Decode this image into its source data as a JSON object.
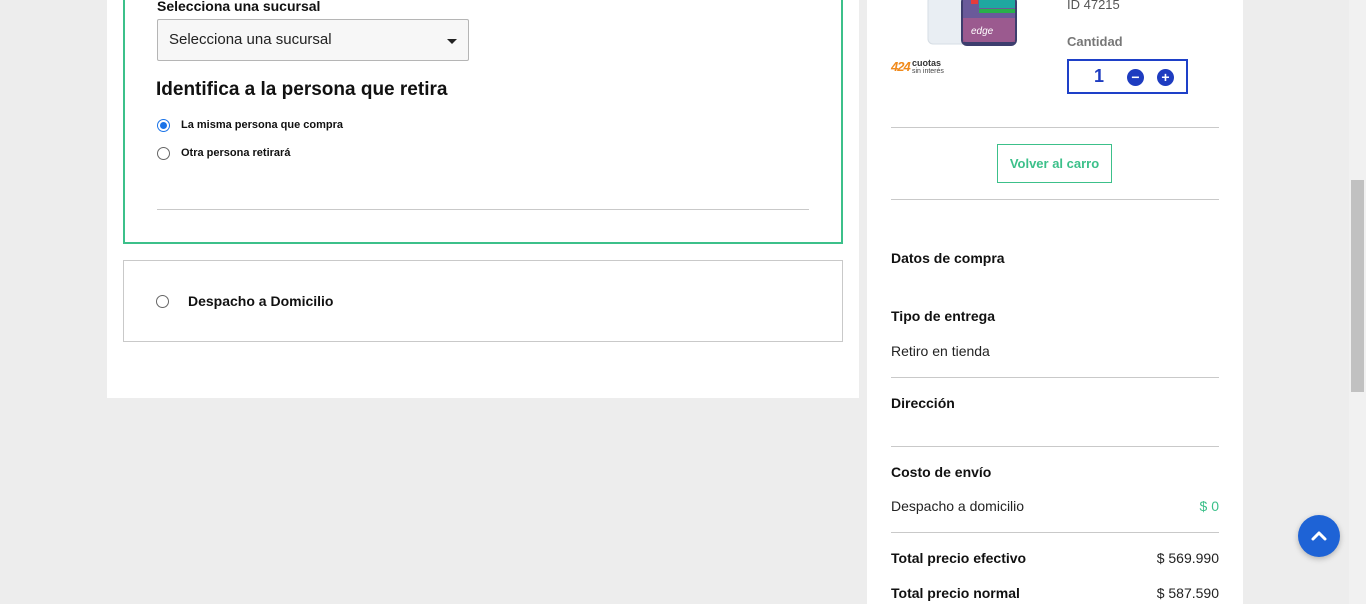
{
  "store_pickup": {
    "branch_label": "Selecciona una sucursal",
    "branch_select_value": "Selecciona una sucursal",
    "identify_title": "Identifica a la persona que retira",
    "options": [
      {
        "label": "La misma persona que compra",
        "checked": true
      },
      {
        "label": "Otra persona retirará",
        "checked": false
      }
    ]
  },
  "home_delivery": {
    "label": "Despacho a Domicilio",
    "checked": false
  },
  "product": {
    "image_icon": "phone-product-image",
    "badge_number": "424",
    "badge_line1": "cuotas",
    "badge_line2": "sin interés",
    "id_text": "ID 47215",
    "quantity_label": "Cantidad",
    "quantity_value": "1",
    "minus_symbol": "−",
    "plus_symbol": "+"
  },
  "cart": {
    "back_label": "Volver al carro"
  },
  "summary": {
    "title": "Datos de compra",
    "delivery_type_label": "Tipo de entrega",
    "delivery_type_value": "Retiro en tienda",
    "address_label": "Dirección",
    "shipping_label": "Costo de envío",
    "shipping_method": "Despacho a domicilio",
    "shipping_cost": "$ 0",
    "total_cash_label": "Total precio efectivo",
    "total_cash_value": "$ 569.990",
    "total_normal_label": "Total precio normal",
    "total_normal_value": "$ 587.590"
  },
  "colors": {
    "accent_green": "#3cc08a",
    "accent_blue": "#1e3cc0",
    "radio_blue": "#1a73e8"
  }
}
